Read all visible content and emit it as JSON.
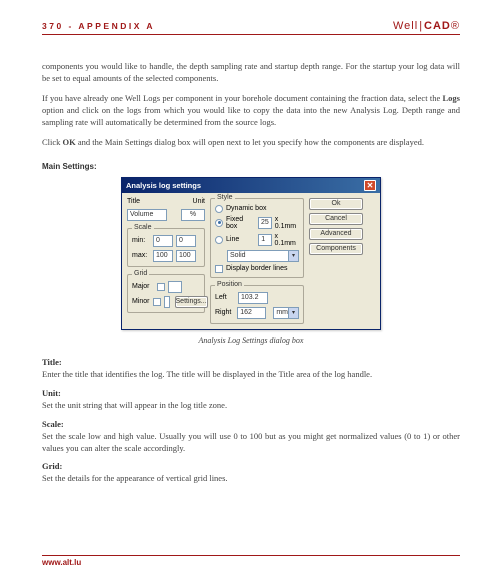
{
  "header": {
    "page": "370 - APPENDIX A",
    "brand_left": "Well",
    "brand_right": "CAD"
  },
  "paragraphs": {
    "p1": "components you would like to handle, the depth sampling rate and startup depth range. For the startup your log data will be set to equal amounts of the selected components.",
    "p2_a": "If you have already one Well Logs per component in your borehole document containing the fraction data, select the ",
    "p2_b": "Logs",
    "p2_c": " option and click on the logs from which you would like to copy the data into the new Analysis Log. Depth range and sampling rate will automatically be determined from the source logs.",
    "p3_a": "Click ",
    "p3_b": "OK",
    "p3_c": " and the Main Settings dialog box will open next to let you specify how the components are displayed."
  },
  "main_settings_label": "Main Settings:",
  "dialog": {
    "title": "Analysis log settings",
    "labels": {
      "title": "Title",
      "volume": "Volume",
      "unit": "Unit",
      "percent": "%",
      "scale": "Scale",
      "min": "min:",
      "max": "max:",
      "min_v": "0",
      "min_v2": "0",
      "max_v": "100",
      "max_v2": "100",
      "grid": "Grid",
      "major": "Major",
      "minor": "Minor",
      "settings": "Settings...",
      "style": "Style",
      "dynamic": "Dynamic box",
      "fixed": "Fixed box",
      "line": "Line",
      "fixed_v": "25",
      "fixed_u": "x 0.1mm",
      "line_v": "1",
      "line_u": "x 0.1mm",
      "solid": "Solid",
      "display_lines": "Display border lines",
      "position": "Position",
      "left": "Left",
      "right": "Right",
      "left_v": "103.2",
      "right_v": "162",
      "mm": "mm"
    },
    "buttons": {
      "ok": "Ok",
      "cancel": "Cancel",
      "advanced": "Advanced",
      "components": "Components"
    }
  },
  "dialog_caption": "Analysis Log Settings dialog box",
  "defs": {
    "title_h": "Title:",
    "title_b": "Enter the title that identifies the log. The title will be displayed in the Title area of the log handle.",
    "unit_h": "Unit:",
    "unit_b": "Set the unit string that will appear in the log title zone.",
    "scale_h": "Scale:",
    "scale_b": "Set the scale low and high value. Usually you will use 0 to 100 but as you might get normalized values (0 to 1) or other values you can alter the scale accordingly.",
    "grid_h": "Grid:",
    "grid_b": "Set the details for the appearance of vertical grid lines."
  },
  "footer": "www.alt.lu"
}
